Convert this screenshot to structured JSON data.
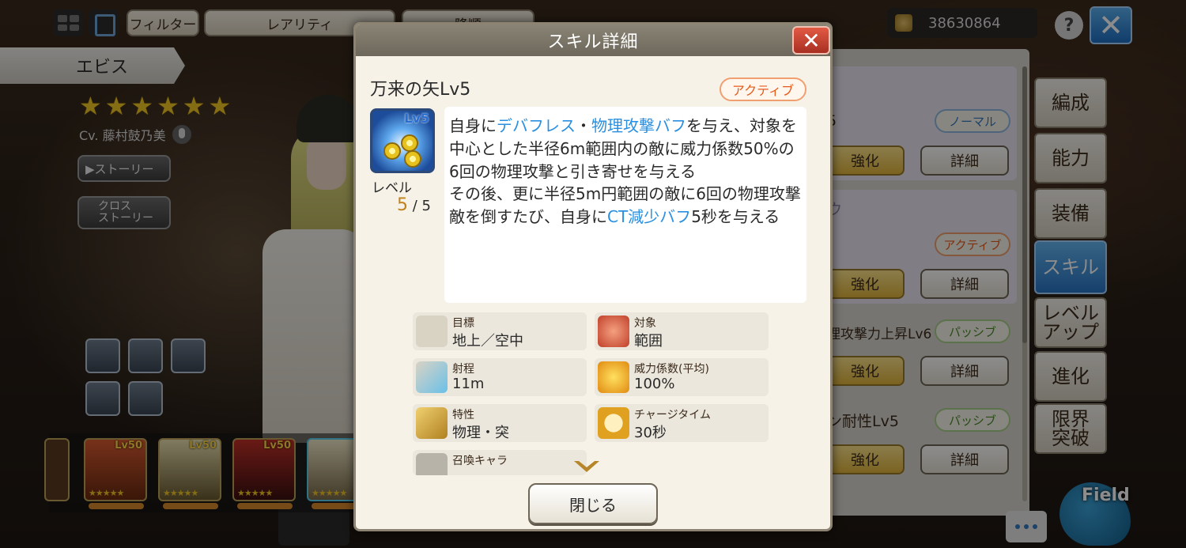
{
  "topbar": {
    "filter_label": "フィルター",
    "rarity_label": "レアリティ",
    "sort_label": "降順",
    "currency_value": "38630864",
    "help_label": "?",
    "close_label": "✕"
  },
  "character": {
    "name": "エビス",
    "stars": [
      "★",
      "★",
      "★",
      "★",
      "★",
      "★"
    ],
    "cv": "Cv. 藤村鼓乃美",
    "story_button": "▶ストーリー",
    "cross_story_button_line1": "クロス",
    "cross_story_button_line2": "ストーリー"
  },
  "roster": [
    {
      "level": "Lv50",
      "stars": "★★★★★"
    },
    {
      "level": "Lv50",
      "stars": "★★★★★"
    },
    {
      "level": "Lv50",
      "stars": "★★★★★"
    },
    {
      "level": "",
      "stars": "★★★★★"
    }
  ],
  "right_panel": {
    "row1_text": "5",
    "row1_tag": "ノーマル",
    "row2_text": "ウ",
    "row2_tag": "アクティブ",
    "row3_text": "理攻撃力上昇Lv6",
    "row3_tag": "パッシブ",
    "row4_text": "ン耐性Lv5",
    "row4_tag": "パッシブ",
    "strengthen_label": "強化",
    "detail_label": "詳細"
  },
  "tabs": [
    {
      "label": "編成"
    },
    {
      "label": "能力"
    },
    {
      "label": "装備"
    },
    {
      "label": "スキル"
    },
    {
      "label": "レベル\nアップ"
    },
    {
      "label": "進化"
    },
    {
      "label": "限界\n突破"
    }
  ],
  "field_label": "Field",
  "modal": {
    "title": "スキル詳細",
    "close_icon": "✕",
    "skill_name": "万来の矢Lv5",
    "skill_type": "アクティブ",
    "icon_level": "Lv5",
    "level_label": "レベル",
    "level_current": "5",
    "level_max": " / 5",
    "description": {
      "p1": "自身に",
      "hl1": "デバフレス",
      "p2": "・",
      "hl2": "物理攻撃バフ",
      "p3": "を与え、対象を中心とした半径6m範囲内の敵に威力係数50%の6回の物理攻撃と引き寄せを与える",
      "p4": "その後、更に半径5m円範囲の敵に6回の物理攻撃",
      "p5": "敵を倒すたび、自身に",
      "hl3": "CT減少バフ",
      "p6": "5秒を与える"
    },
    "attributes": {
      "target_label": "目標",
      "target_value": "地上／空中",
      "object_label": "対象",
      "object_value": "範囲",
      "range_label": "射程",
      "range_value": "11m",
      "power_label": "威力係数(平均)",
      "power_value": "100%",
      "trait_label": "特性",
      "trait_value": "物理・突",
      "charge_label": "チャージタイム",
      "charge_value": "30秒",
      "summon_label": "召喚キャラ"
    },
    "close_button": "閉じる"
  },
  "colors": {
    "highlight": "#2a8fe0",
    "active": "#e65a1c",
    "gold": "#e0b43c",
    "selected_tab": "#2a76c6"
  }
}
